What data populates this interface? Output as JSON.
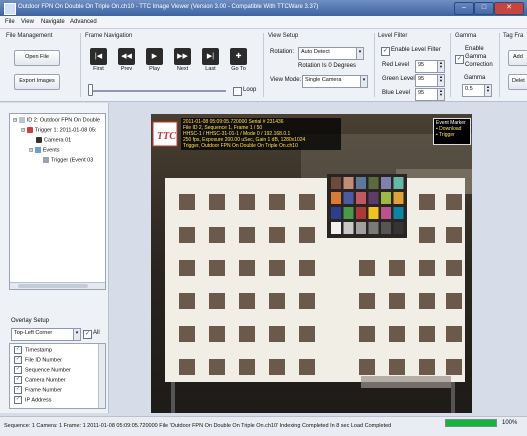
{
  "window": {
    "title": "Outdoor FPN On Double On Triple On.ch10 - TTC Image Viewer (Version 3.00 - Compatible With TTCWare 3.37)",
    "controls": [
      "–",
      "□",
      "✕"
    ]
  },
  "menu": [
    "File",
    "View",
    "Navigate",
    "Advanced"
  ],
  "file_management": {
    "title": "File Management",
    "open_label": "Open File",
    "export_label": "Export Images"
  },
  "frame_navigation": {
    "title": "Frame Navigation",
    "buttons": [
      {
        "label": "First",
        "icon": "skip-first-icon",
        "glyph": "|◀"
      },
      {
        "label": "Prev",
        "icon": "step-back-icon",
        "glyph": "◀◀"
      },
      {
        "label": "Play",
        "icon": "play-icon",
        "glyph": "▶"
      },
      {
        "label": "Next",
        "icon": "step-forward-icon",
        "glyph": "▶▶"
      },
      {
        "label": "Last",
        "icon": "skip-last-icon",
        "glyph": "▶|"
      },
      {
        "label": "Go To",
        "icon": "goto-icon",
        "glyph": "✚"
      }
    ],
    "loop_label": "Loop"
  },
  "view_setup": {
    "title": "View Setup",
    "rotation_label": "Rotation:",
    "rotation_value": "Auto Detect",
    "rotation_info": "Rotation Is 0 Degrees",
    "viewmode_label": "View Mode:",
    "viewmode_value": "Single Camera"
  },
  "level_filter": {
    "title": "Level Filter",
    "enable_label": "Enable Level Filter",
    "red_label": "Red Level",
    "red_value": "95",
    "green_label": "Green Level",
    "green_value": "95",
    "blue_label": "Blue Level",
    "blue_value": "95"
  },
  "gamma": {
    "title": "Gamma",
    "enable_label_1": "Enable",
    "enable_label_2": "Gamma",
    "enable_label_3": "Correction",
    "gamma_label": "Gamma",
    "gamma_value": "0.5"
  },
  "tag_frame": {
    "title": "Tag Fra",
    "add_label": "Add",
    "delete_label": "Delet"
  },
  "tree": {
    "items": [
      {
        "text": "ID 2: Outdoor FPN On Double",
        "indent": 0
      },
      {
        "text": "Trigger 1: 2011-01-08 05:",
        "indent": 1
      },
      {
        "text": "Camera 01",
        "indent": 2
      },
      {
        "text": "Events",
        "indent": 2
      },
      {
        "text": "Trigger (Event 03",
        "indent": 3
      }
    ]
  },
  "overlay_setup": {
    "title": "Overlay Setup",
    "position_value": "Top-Left Corner",
    "all_label": "All",
    "items": [
      "Timestamp",
      "File ID Number",
      "Sequence Number",
      "Camera Number",
      "Frame Number",
      "IP Address"
    ]
  },
  "overlay_text": [
    "2011-01-08 05:09:05.720000    Serial # 231436",
    "File ID 2, Sequence 1, Frame 1 / 50",
    "HHSC-1 / HHSC-31-01-1 / Mode 0 / 192.168.0.1",
    "250 fps, Exposure 200.00 uSec, Gain 1 dB, 1280x1024",
    "Trigger, Outdoor FPN On Double On Triple On.ch10"
  ],
  "event_marker": {
    "title": "Event Marker",
    "items": [
      "Download",
      "Trigger"
    ]
  },
  "status": {
    "text": "Sequence: 1    Camera: 1    Frame: 1      2011-01-08 05:09:05.720000   File 'Outdoor FPN On Double On Triple On.ch10' Indexing Completed In 8 sec  Load Completed",
    "progress_fraction": 1.0,
    "progress_label": "100%"
  },
  "colors": {
    "progress_fill": "#17b43a",
    "overlay_text": "#ffe14d"
  }
}
